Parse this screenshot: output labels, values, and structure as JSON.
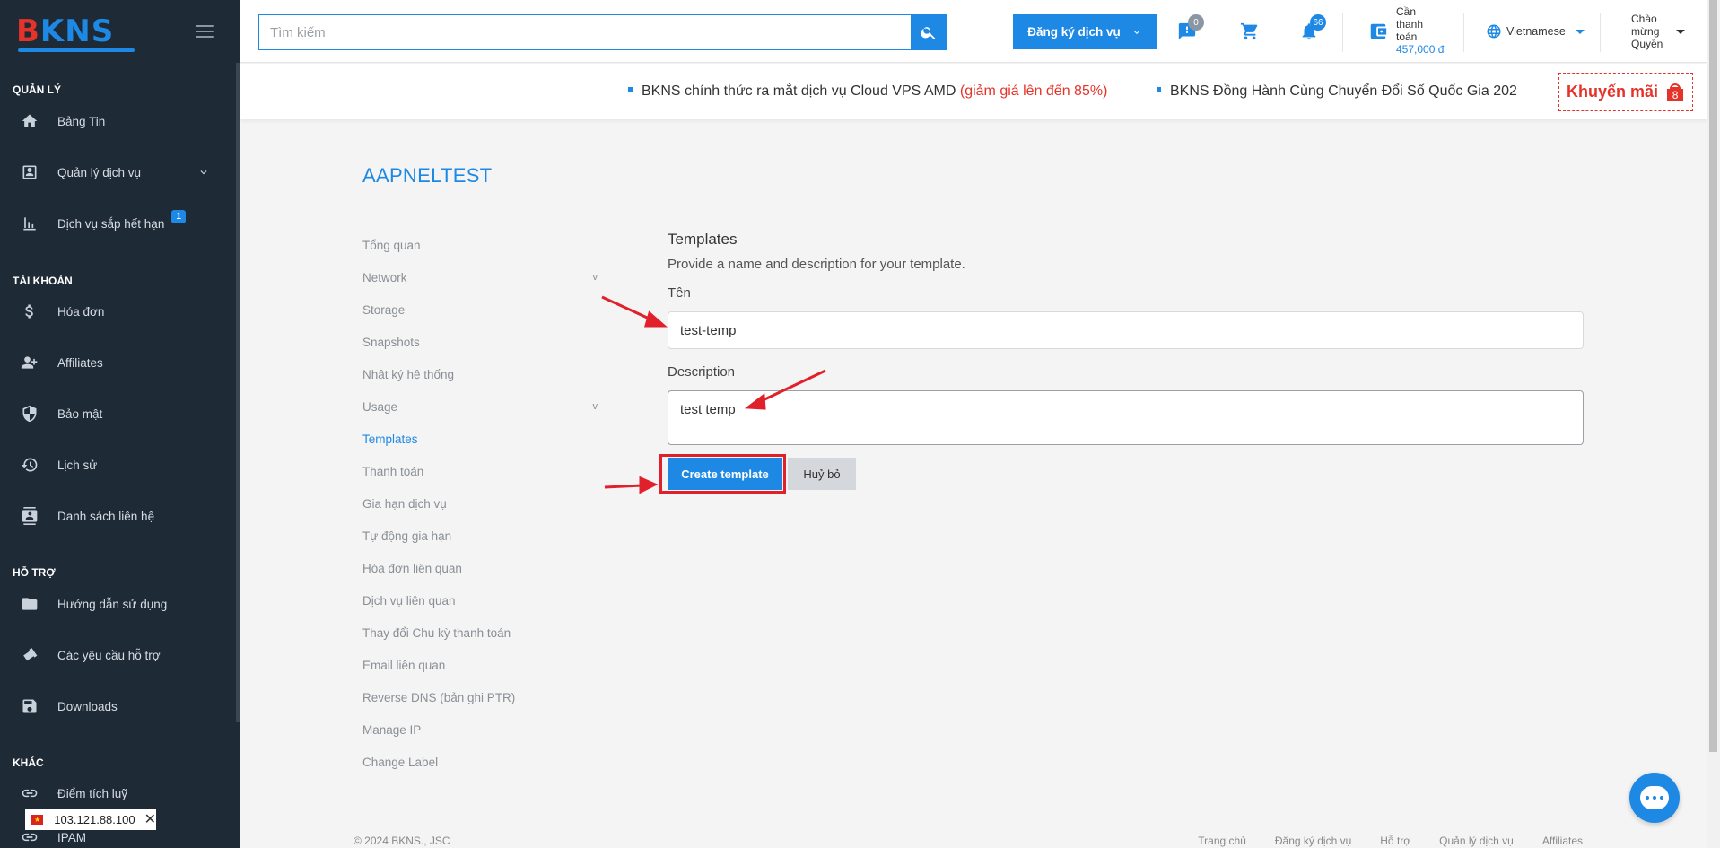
{
  "brand": {
    "logo_first": "B",
    "logo_rest": "KNS"
  },
  "sidebar": {
    "sections": [
      {
        "title": "QUẢN LÝ"
      },
      {
        "title": "TÀI KHOẢN"
      },
      {
        "title": "HỖ TRỢ"
      },
      {
        "title": "KHÁC"
      }
    ],
    "items": [
      {
        "label": "Bảng Tin",
        "icon": "home-icon"
      },
      {
        "label": "Quản lý dịch vụ",
        "icon": "account-box-icon"
      },
      {
        "label": "Dịch vụ sắp hết hạn",
        "icon": "bar-chart-icon",
        "badge": "1"
      },
      {
        "label": "Hóa đơn",
        "icon": "dollar-icon"
      },
      {
        "label": "Affiliates",
        "icon": "people-add-icon"
      },
      {
        "label": "Bảo mật",
        "icon": "shield-icon"
      },
      {
        "label": "Lịch sử",
        "icon": "history-icon"
      },
      {
        "label": "Danh sách liên hệ",
        "icon": "contact-card-icon"
      },
      {
        "label": "Hướng dẫn sử dụng",
        "icon": "folder-icon"
      },
      {
        "label": "Các yêu cầu hỗ trợ",
        "icon": "ticket-icon"
      },
      {
        "label": "Downloads",
        "icon": "save-icon"
      },
      {
        "label": "Điểm tích luỹ",
        "icon": "link-icon"
      },
      {
        "label": "IPAM",
        "icon": "link-icon"
      }
    ],
    "ip_address": "103.121.88.100"
  },
  "header": {
    "search_placeholder": "Tìm kiếm",
    "register_label": "Đăng ký dịch vụ",
    "tickets_count": "0",
    "notifications_count": "66",
    "balance_label_1": "Cần",
    "balance_label_2": "thanh",
    "balance_label_3": "toán",
    "balance_amount": "457,000 đ",
    "language": "Vietnamese",
    "greeting_1": "Chào",
    "greeting_2": "mừng",
    "greeting_3": "Quyền",
    "accent_color": "#1e88e5"
  },
  "news": {
    "item1_text": "BKNS chính thức ra mắt dịch vụ Cloud VPS AMD ",
    "item1_highlight": "(giảm giá lên đến 85%)",
    "item2_text": "BKNS Đồng Hành Cùng Chuyển Đổi Số Quốc Gia 202",
    "promo_label": "Khuyến mãi",
    "promo_count": "8"
  },
  "main": {
    "title": "AAPNELTEST",
    "subnav": [
      {
        "label": "Tổng quan"
      },
      {
        "label": "Network",
        "expand": "v"
      },
      {
        "label": "Storage"
      },
      {
        "label": "Snapshots"
      },
      {
        "label": "Nhật ký hệ thống"
      },
      {
        "label": "Usage",
        "expand": "v"
      },
      {
        "label": "Templates"
      },
      {
        "label": "Thanh toán"
      },
      {
        "label": "Gia hạn dịch vụ"
      },
      {
        "label": "Tự động gia hạn"
      },
      {
        "label": "Hóa đơn liên quan"
      },
      {
        "label": "Dịch vụ liên quan"
      },
      {
        "label": "Thay đổi Chu kỳ thanh toán"
      },
      {
        "label": "Email liên quan"
      },
      {
        "label": "Reverse DNS (bản ghi PTR)"
      },
      {
        "label": "Manage IP"
      },
      {
        "label": "Change Label"
      }
    ],
    "form": {
      "heading": "Templates",
      "description": "Provide a name and description for your template.",
      "name_label": "Tên",
      "name_value": "test-temp",
      "desc_label": "Description",
      "desc_value": "test temp",
      "create_label": "Create template",
      "cancel_label": "Huỷ bỏ"
    }
  },
  "footer": {
    "copyright": "© 2024 BKNS., JSC",
    "links": [
      "Trang chủ",
      "Đăng ký dịch vụ",
      "Hỗ trợ",
      "Quản lý dịch vụ",
      "Affiliates"
    ]
  }
}
